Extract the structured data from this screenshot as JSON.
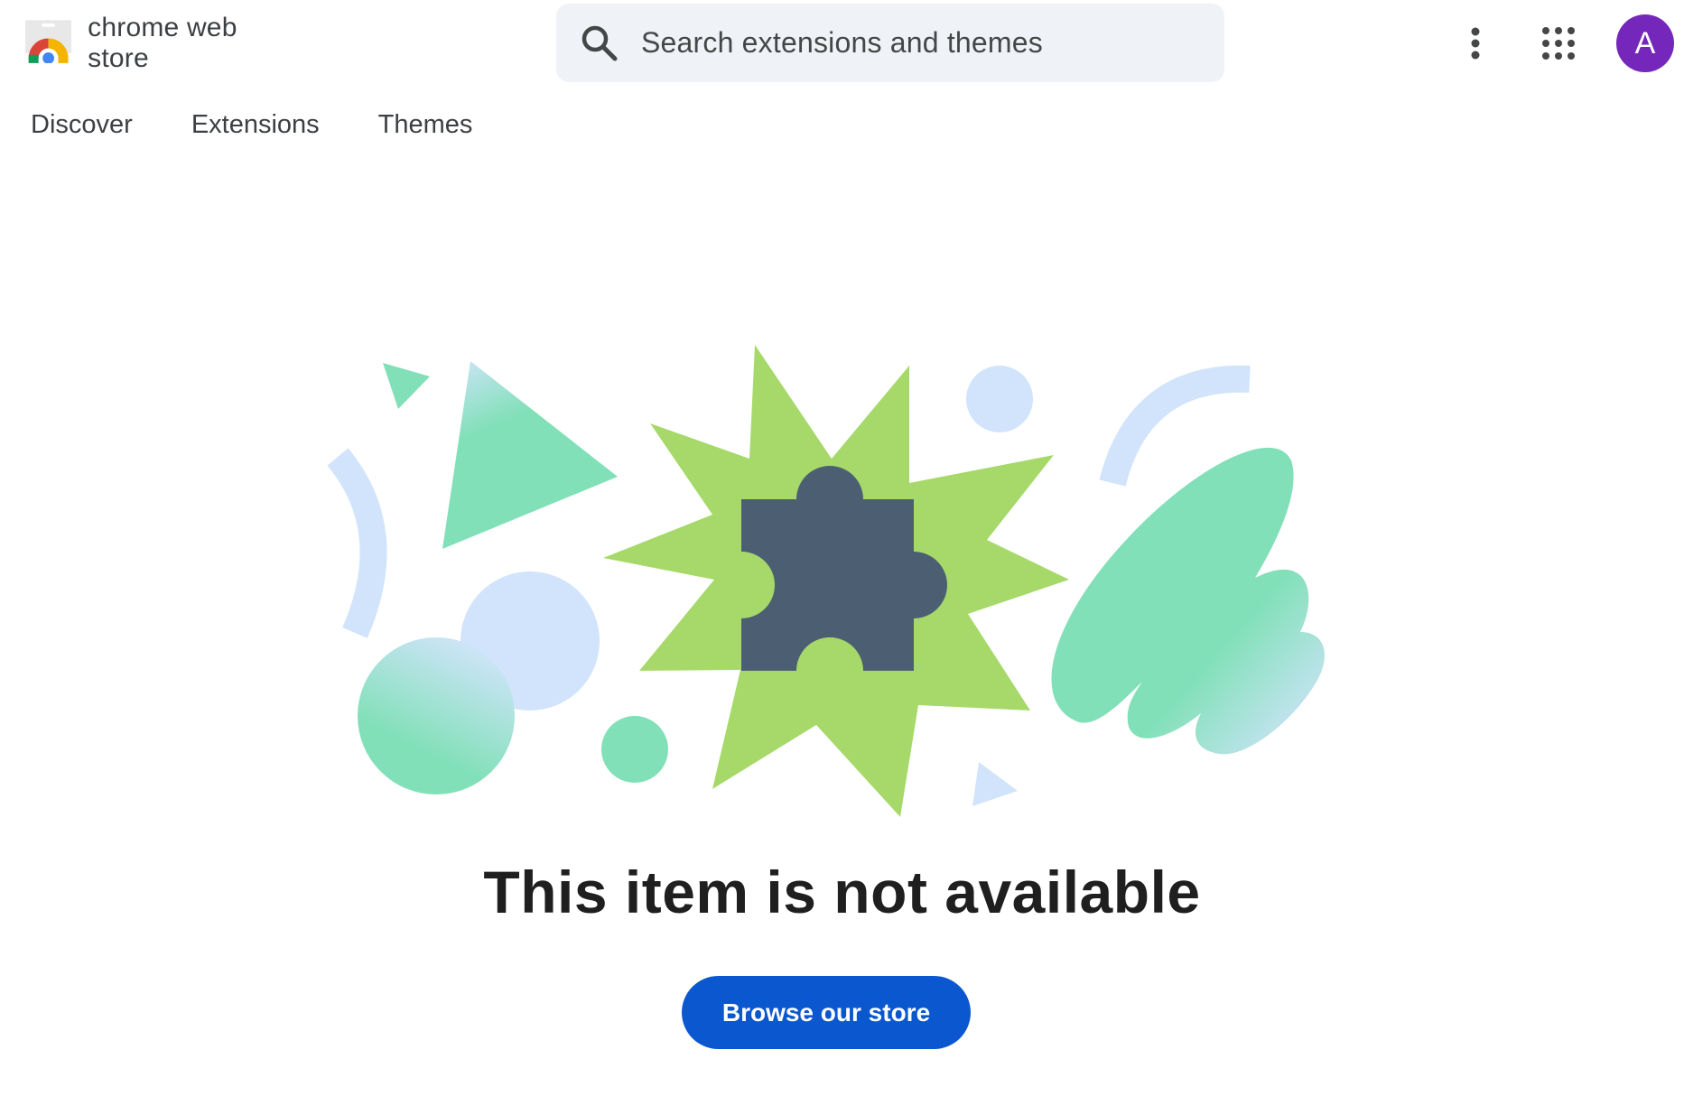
{
  "header": {
    "logo_text": "chrome web store",
    "search": {
      "placeholder": "Search extensions and themes",
      "icon": "search-icon"
    },
    "more_icon": "more-vert-icon",
    "apps_icon": "apps-grid-icon",
    "avatar_letter": "A",
    "avatar_color": "#7627bb"
  },
  "nav": {
    "items": [
      {
        "label": "Discover"
      },
      {
        "label": "Extensions"
      },
      {
        "label": "Themes"
      }
    ]
  },
  "main": {
    "illustration_icon": "puzzle-piece-icon",
    "heading": "This item is not available",
    "browse_button_label": "Browse our store"
  },
  "colors": {
    "accent": "#0b57d0",
    "puzzle": "#4c5f72",
    "burst": "#a6d96a",
    "mint": "#81e0b8",
    "light_blue": "#d1e4fb"
  }
}
